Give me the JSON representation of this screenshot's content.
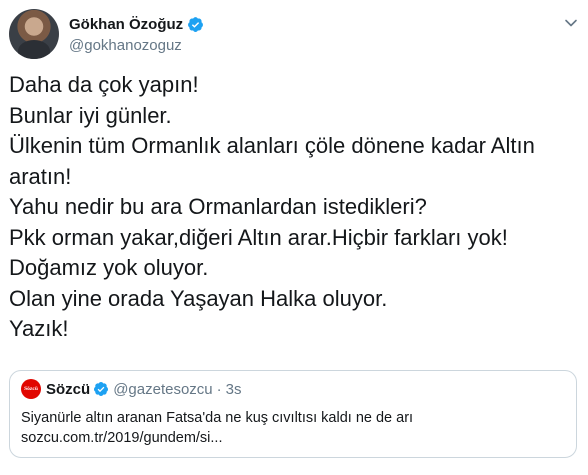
{
  "tweet": {
    "author": {
      "display_name": "Gökhan Özoğuz",
      "handle": "@gokhanozoguz",
      "verified": true
    },
    "lines": [
      "Daha da çok yapın!",
      "Bunlar iyi günler.",
      "Ülkenin tüm Ormanlık alanları çöle dönene kadar Altın",
      "aratın!",
      "Yahu nedir bu ara Ormanlardan istedikleri?",
      "Pkk orman yakar,diğeri Altın arar.Hiçbir farkları yok!",
      "Doğamız yok oluyor.",
      "Olan yine orada Yaşayan Halka oluyor.",
      "Yazık!"
    ]
  },
  "quote": {
    "avatar_label": "Sözcü",
    "display_name": "Sözcü",
    "handle": "@gazetesozcu",
    "separator": "·",
    "time": "3s",
    "text": "Siyanürle altın aranan Fatsa'da ne kuş cıvıltısı kaldı ne de arı",
    "link": "sozcu.com.tr/2019/gundem/si..."
  },
  "icons": {
    "verified": "verified-badge-icon",
    "more": "chevron-down-icon"
  },
  "colors": {
    "accent": "#1da1f2",
    "text": "#14171a",
    "muted": "#657786",
    "border": "#ccd6dd",
    "brand_sozcu": "#e10600"
  }
}
